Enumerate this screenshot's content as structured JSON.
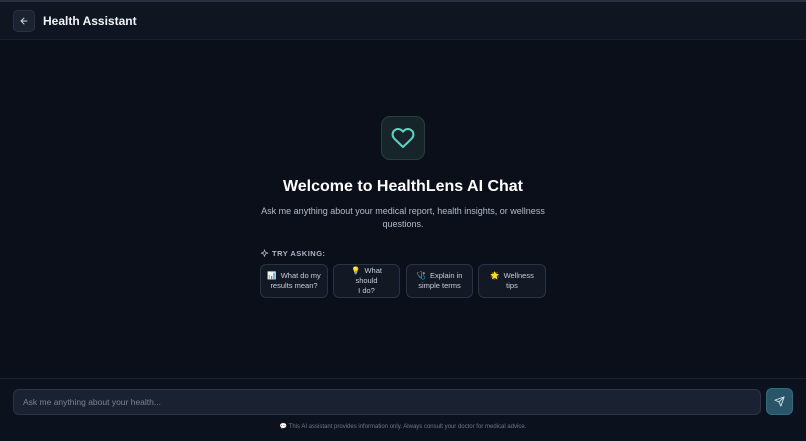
{
  "header": {
    "title": "Health Assistant",
    "back_icon": "arrow-left-icon"
  },
  "hero": {
    "icon": "heart-icon",
    "accent_color": "#5fd3c4",
    "title": "Welcome to HealthLens AI Chat",
    "subtitle": "Ask me anything about your medical report, health insights, or wellness questions."
  },
  "suggestions": {
    "label": "TRY ASKING:",
    "label_icon": "sparkle-icon",
    "chips": [
      {
        "emoji": "📊",
        "label_line1": "What do my",
        "label_line2": "results mean?"
      },
      {
        "emoji": "💡",
        "label_line1": "What should",
        "label_line2": "I do?"
      },
      {
        "emoji": "🩺",
        "label_line1": "Explain in",
        "label_line2": "simple terms"
      },
      {
        "emoji": "🌟",
        "label_line1": "Wellness tips",
        "label_line2": ""
      }
    ]
  },
  "composer": {
    "placeholder": "Ask me anything about your health...",
    "value": "",
    "send_icon": "send-icon"
  },
  "disclaimer": "💬 This AI assistant provides information only. Always consult your doctor for medical advice."
}
